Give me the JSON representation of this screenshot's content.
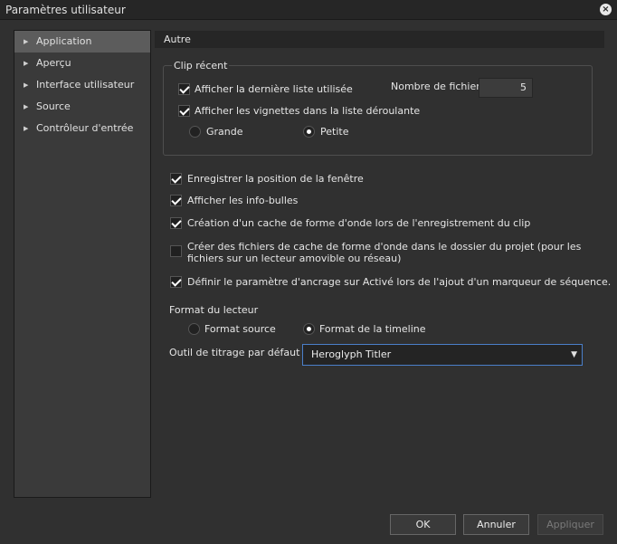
{
  "window": {
    "title": "Paramètres utilisateur"
  },
  "sidebar": {
    "items": [
      {
        "label": "Application"
      },
      {
        "label": "Aperçu"
      },
      {
        "label": "Interface utilisateur"
      },
      {
        "label": "Source"
      },
      {
        "label": "Contrôleur d'entrée"
      }
    ]
  },
  "panel": {
    "header": "Autre"
  },
  "recent_clip": {
    "title": "Clip récent",
    "show_last_list": "Afficher la dernière liste utilisée",
    "file_count_label": "Nombre de fichiers",
    "file_count_value": "5",
    "show_thumbnails": "Afficher les vignettes dans la liste déroulante",
    "size_large": "Grande",
    "size_small": "Petite"
  },
  "options": {
    "save_window_position": "Enregistrer la position de la fenêtre",
    "show_tooltips": "Afficher les info-bulles",
    "waveform_cache_on_record": "Création d'un cache de forme d'onde lors de l'enregistrement du clip",
    "waveform_cache_in_project_1": "Créer des fichiers de cache de forme d'onde dans le dossier du projet (pour les",
    "waveform_cache_in_project_2": "fichiers sur un lecteur amovible ou réseau)",
    "anchor_on_marker": "Définir le paramètre d'ancrage sur Activé lors de l'ajout d'un marqueur de séquence."
  },
  "player_format": {
    "label": "Format du lecteur",
    "source": "Format source",
    "timeline": "Format de la timeline"
  },
  "titler": {
    "label": "Outil de titrage par défaut",
    "selected": "Heroglyph Titler"
  },
  "buttons": {
    "ok": "OK",
    "cancel": "Annuler",
    "apply": "Appliquer"
  },
  "colors": {
    "background": "#303030",
    "sidebar_active": "#5c5c5c",
    "focus_border": "#4a7fc9"
  }
}
